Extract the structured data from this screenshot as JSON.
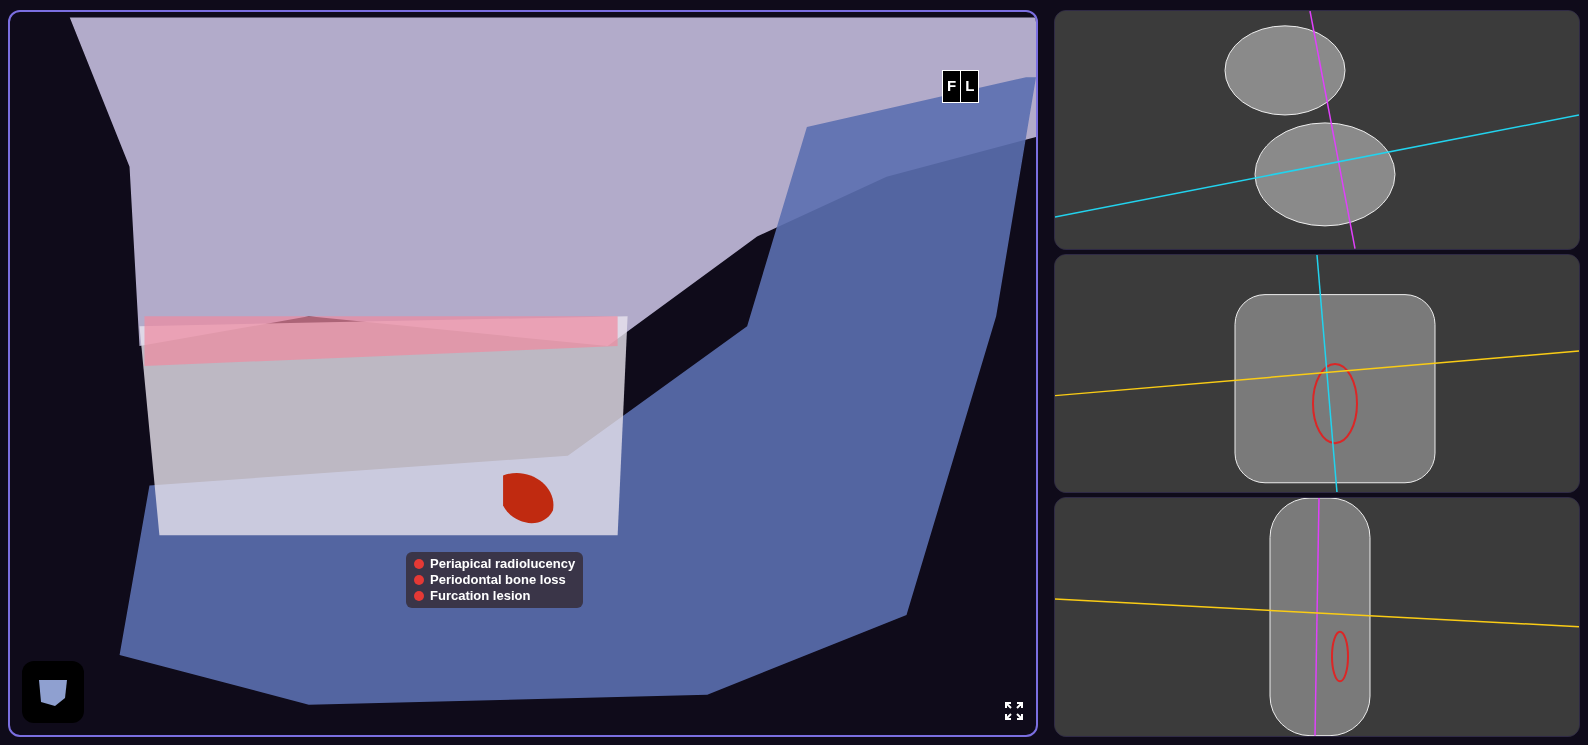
{
  "viewer": {
    "orientation_cube": {
      "faces": [
        "F",
        "L"
      ]
    },
    "findings": [
      {
        "label": "Periapical radiolucency"
      },
      {
        "label": "Periodontal bone loss"
      },
      {
        "label": "Furcation lesion"
      }
    ]
  },
  "slices": [
    {
      "kind": "axial"
    },
    {
      "kind": "coronal"
    },
    {
      "kind": "sagittal"
    }
  ]
}
